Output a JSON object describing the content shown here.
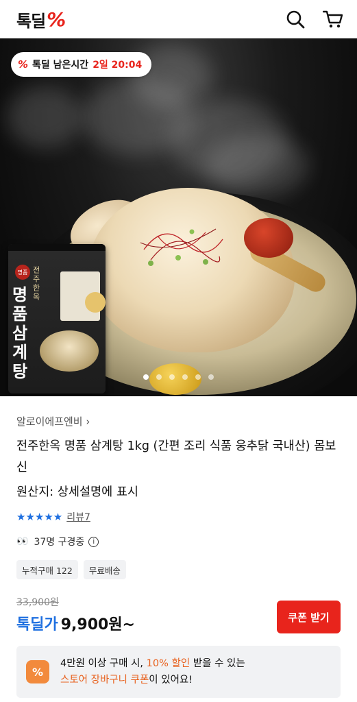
{
  "header": {
    "logo_text": "톡딜",
    "logo_mark": "%",
    "icons": [
      "search-icon",
      "cart-icon"
    ]
  },
  "hero": {
    "timer_mark": "%",
    "timer_label": "톡딜 남은시간",
    "timer_value": "2일 20:04",
    "package": {
      "badge": "명품",
      "small": "전주한옥",
      "title": "명품삼계탕"
    },
    "carousel_total": 6,
    "carousel_active": 1
  },
  "product": {
    "seller": "알로이에프엔비",
    "seller_chevron": "›",
    "title": "전주한옥 명품 삼계탕 1kg (간편 조리 식품 웅추닭 국내산) 몸보신",
    "origin": "원산지: 상세설명에 표시",
    "stars": "★★★★★",
    "review": "리뷰7",
    "watch_eyes": "👀",
    "watch": "37명 구경중",
    "info_mark": "i",
    "tags": [
      "누적구매 122",
      "무료배송"
    ],
    "original_price": "33,900원",
    "deal_label": "톡딜가",
    "deal_price": "9,900원~",
    "coupon_button": "쿠폰 받기"
  },
  "banner": {
    "icon": "%",
    "line1_pre": "4만원 이상 구매 시, ",
    "line1_hl": "10% 할인",
    "line1_post": " 받을 수 있는",
    "line2_hl": "스토어 장바구니 쿠폰",
    "line2_post": "이 있어요!"
  },
  "colors": {
    "brand_red": "#e8241c",
    "deal_blue": "#1e6fe0",
    "coupon_orange": "#e8601c"
  }
}
